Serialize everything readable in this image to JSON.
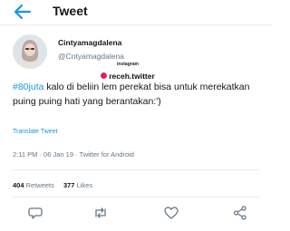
{
  "header": {
    "title": "Tweet"
  },
  "user": {
    "name": "Cintyamagdalena",
    "handle": "@Cntyamagdalena"
  },
  "watermark": {
    "small": "instagram",
    "big": "receh.twitter"
  },
  "tweet": {
    "hashtag": "#80juta",
    "body": " kalo di beliin lem perekat bisa untuk merekatkan puing puing hati yang berantakan:')",
    "translate_label": "Translate Tweet"
  },
  "meta": {
    "time": "2:11 PM",
    "sep1": " · ",
    "date": "06 Jan 19",
    "sep2": " · ",
    "source": "Twitter for Android"
  },
  "stats": {
    "retweets_count": "404",
    "retweets_label": "Retweets",
    "likes_count": "377",
    "likes_label": "Likes"
  },
  "colors": {
    "link": "#1b95e0",
    "secondary": "#657786",
    "divider": "#e6ecf0"
  },
  "icons": [
    "back-arrow-icon",
    "reply-icon",
    "retweet-icon",
    "like-icon",
    "share-icon"
  ]
}
